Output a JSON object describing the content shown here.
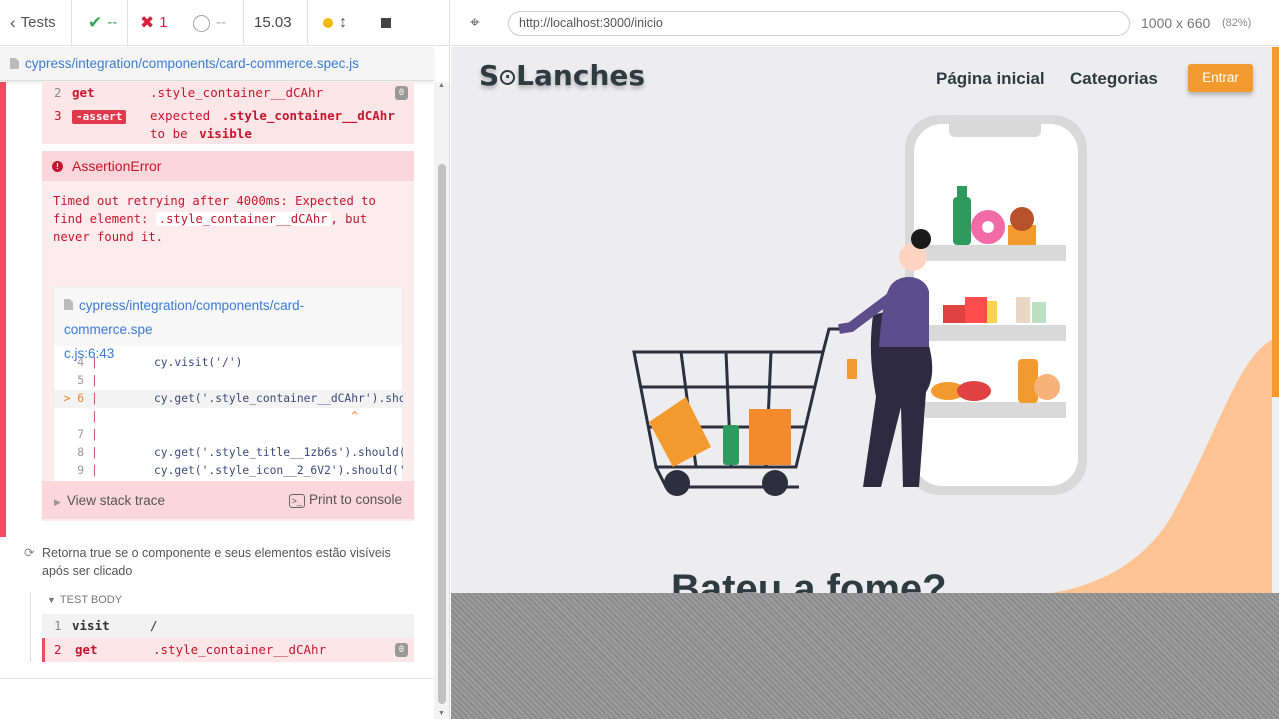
{
  "runner": {
    "tests_label": "Tests",
    "passed": "--",
    "failed": "1",
    "pending": "--",
    "duration": "15.03",
    "accent_color": "#f5b800"
  },
  "spec": {
    "path": "cypress/integration/components/card-commerce.spec.js"
  },
  "commands_top": [
    {
      "num": "2",
      "name": "get",
      "value": ".style_container__dCAhr",
      "badge": "0"
    },
    {
      "num": "3",
      "name": "-assert",
      "expected": "expected",
      "selector": ".style_container__dCAhr",
      "to_be": "to be",
      "visible": "visible"
    }
  ],
  "error": {
    "title": "AssertionError",
    "msg_part1": "Timed out retrying after 4000ms: Expected to find element:",
    "msg_selector": ".style_container__dCAhr",
    "msg_part2": ", but never found it.",
    "code_file_line1": "cypress/integration/components/card-commerce.spe",
    "code_file_line2": "c.js:6:43",
    "code_lines": [
      {
        "ln": "4",
        "src": "cy.visit('/')"
      },
      {
        "ln": "5",
        "src": ""
      },
      {
        "ln": "> 6",
        "src": "cy.get('.style_container__dCAhr').shou"
      },
      {
        "ln": "",
        "src": "                             ^"
      },
      {
        "ln": "7",
        "src": ""
      },
      {
        "ln": "8",
        "src": "cy.get('.style_title__1zb6s').should('"
      },
      {
        "ln": "9",
        "src": "cy.get('.style_icon__2_6V2').should('b"
      }
    ],
    "stack_trace": "View stack trace",
    "print_console": "Print to console"
  },
  "test2": {
    "title": "Retorna true se o componente e seus elementos estão visíveis após ser clicado",
    "body_label": "TEST BODY",
    "commands": [
      {
        "num": "1",
        "name": "visit",
        "value": "/"
      },
      {
        "num": "2",
        "name": "get",
        "value": ".style_container__dCAhr",
        "badge": "0"
      }
    ]
  },
  "browser": {
    "url": "http://localhost:3000/inicio",
    "size": "1000 x 660",
    "zoom": "(82%)"
  },
  "app": {
    "logo_s": "S",
    "logo_rest": "Lanches",
    "nav_home": "Página inicial",
    "nav_categories": "Categorias",
    "btn_enter": "Entrar",
    "headline": "Bateu a fome?",
    "brand_color": "#f29a2e",
    "accent_purple": "#5a4f8c"
  }
}
